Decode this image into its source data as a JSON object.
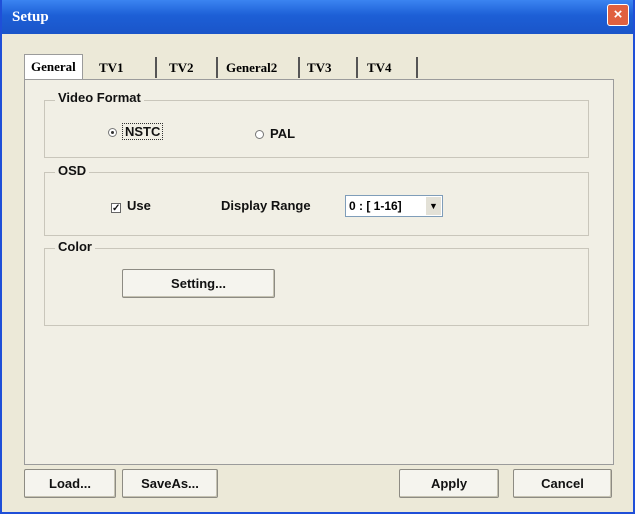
{
  "window": {
    "title": "Setup",
    "close_label": "×"
  },
  "tabs": [
    {
      "label": "General",
      "active": true
    },
    {
      "label": "TV1"
    },
    {
      "label": "TV2"
    },
    {
      "label": "General2"
    },
    {
      "label": "TV3"
    },
    {
      "label": "TV4"
    }
  ],
  "video_format": {
    "group_label": "Video Format",
    "options": [
      {
        "label": "NSTC",
        "selected": true
      },
      {
        "label": "PAL",
        "selected": false
      }
    ]
  },
  "osd": {
    "group_label": "OSD",
    "use_label": "Use",
    "use_checked": true,
    "check_mark": "✓",
    "display_range_label": "Display Range",
    "display_range_value": "0 : [ 1-16]"
  },
  "color": {
    "group_label": "Color",
    "setting_button": "Setting..."
  },
  "footer": {
    "load": "Load...",
    "save_as": "SaveAs...",
    "apply": "Apply",
    "cancel": "Cancel"
  }
}
